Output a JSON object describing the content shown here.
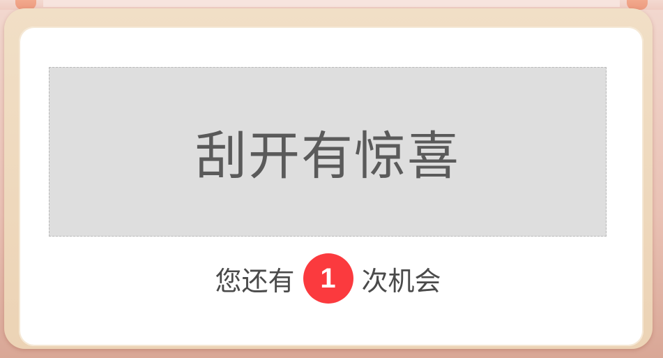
{
  "scratch_card": {
    "prompt": "刮开有惊喜"
  },
  "chances": {
    "prefix": "您还有",
    "count": "1",
    "suffix": "次机会"
  },
  "colors": {
    "badge": "#fb3a3e",
    "scratch_surface": "#dedede",
    "frame": "#ecd3b5",
    "background": "#e9c1b4"
  }
}
